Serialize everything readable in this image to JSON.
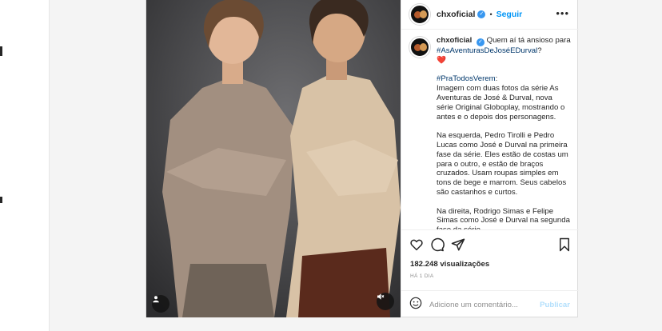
{
  "post": {
    "username": "chxoficial",
    "follow_label": "Seguir",
    "more_label": "•••",
    "caption": {
      "username": "chxoficial",
      "line1": "Quem aí tá ansioso para",
      "hashtag1": "#AsAventurasDeJoséEDurval",
      "after_hashtag1": "?",
      "emoji": "❤️",
      "hashtag2": "#PraTodosVerem",
      "after_hashtag2": ":",
      "para1": "Imagem com duas fotos da série As Aventuras de José & Durval, nova série Original Globoplay, mostrando o antes e o depois dos personagens.",
      "para2": "Na esquerda, Pedro Tirolli e Pedro Lucas como José e Durval na primeira fase da série. Eles estão de costas um para o outro, e estão de braços cruzados. Usam roupas simples em tons de bege e marrom. Seus cabelos são castanhos e curtos.",
      "para3": "Na direita, Rodrigo Simas e Felipe Simas como José e Durval na segunda fase da série."
    },
    "views": "182.248 visualizações",
    "time": "HÁ 1 DIA",
    "comment_placeholder": "Adicione um comentário...",
    "publish_label": "Publicar",
    "icons": [
      "heart-icon",
      "comment-icon",
      "share-icon",
      "bookmark-icon",
      "emoji-icon",
      "user-tag-icon",
      "mute-icon"
    ]
  },
  "colors": {
    "link": "#0095f6",
    "hashtag": "#00376b",
    "muted": "#8e8e8e",
    "verified": "#3897f0"
  }
}
